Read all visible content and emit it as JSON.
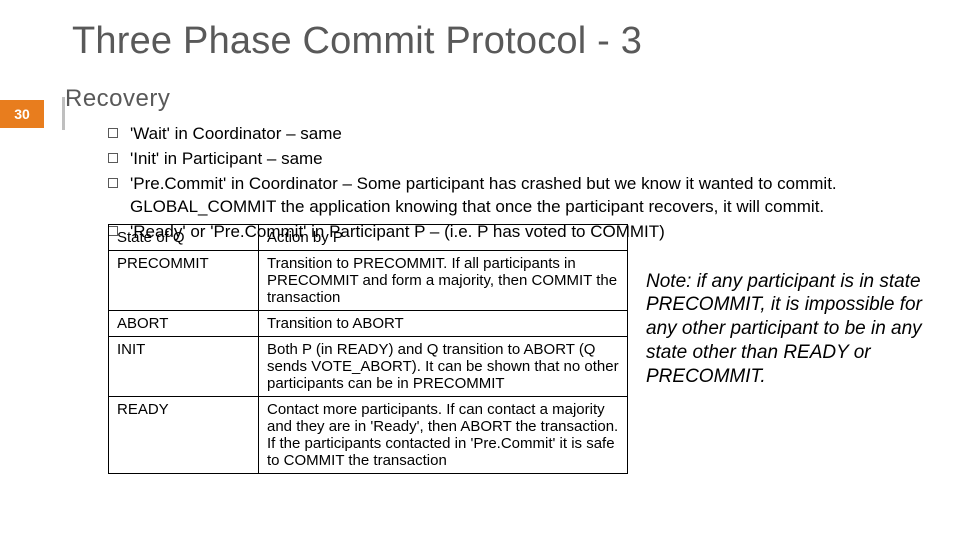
{
  "pageNumber": "30",
  "title": "Three Phase Commit Protocol - 3",
  "subtitle": "Recovery",
  "bullets": [
    "'Wait' in Coordinator – same",
    "'Init' in Participant – same",
    "'Pre.Commit' in Coordinator – Some participant has crashed but we know it wanted to commit.  GLOBAL_COMMIT the application knowing that once the participant recovers, it will commit.",
    "'Ready' or 'Pre.Commit' in Participant P – (i.e. P has voted to COMMIT)"
  ],
  "table": {
    "headers": [
      "State of Q",
      "Action by P"
    ],
    "rows": [
      [
        "PRECOMMIT",
        "Transition to PRECOMMIT.  If all participants in PRECOMMIT and form a majority, then COMMIT the transaction"
      ],
      [
        "ABORT",
        "Transition to ABORT"
      ],
      [
        "INIT",
        "Both P (in READY) and Q transition to ABORT (Q sends VOTE_ABORT). It can be shown that no other participants can be in PRECOMMIT"
      ],
      [
        "READY",
        "Contact more participants.  If can contact a majority and they are in 'Ready', then ABORT the transaction.  If the participants contacted in 'Pre.Commit' it is safe to COMMIT the transaction"
      ]
    ]
  },
  "note": "Note: if any participant is in state PRECOMMIT, it is impossible for any other participant to be in any state other than READY or PRECOMMIT."
}
